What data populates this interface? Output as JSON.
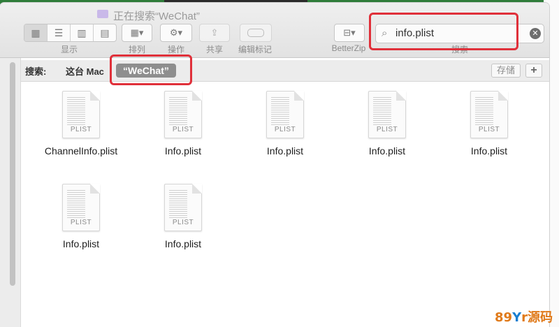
{
  "window": {
    "title": "正在搜索“WeChat”"
  },
  "toolbar": {
    "view_label": "显示",
    "sort_label": "排列",
    "action_label": "操作",
    "share_label": "共享",
    "tags_label": "编辑标记",
    "betterzip_label": "BetterZip",
    "search_label": "搜索"
  },
  "search": {
    "value": "info.plist"
  },
  "scope_bar": {
    "label": "搜索:",
    "this_mac": "这台 Mac",
    "token": "“WeChat”",
    "save_label": "存储",
    "add_label": "+"
  },
  "files": [
    {
      "name": "ChannelInfo.plist",
      "ext": "PLIST"
    },
    {
      "name": "Info.plist",
      "ext": "PLIST"
    },
    {
      "name": "Info.plist",
      "ext": "PLIST"
    },
    {
      "name": "Info.plist",
      "ext": "PLIST"
    },
    {
      "name": "Info.plist",
      "ext": "PLIST"
    },
    {
      "name": "Info.plist",
      "ext": "PLIST"
    },
    {
      "name": "Info.plist",
      "ext": "PLIST"
    }
  ],
  "colors": {
    "highlight": "#e0303a",
    "scope_token_bg": "#8e8e8e"
  },
  "watermark": {
    "text_a": "89",
    "text_b": "Y",
    "text_c": "r源码"
  }
}
